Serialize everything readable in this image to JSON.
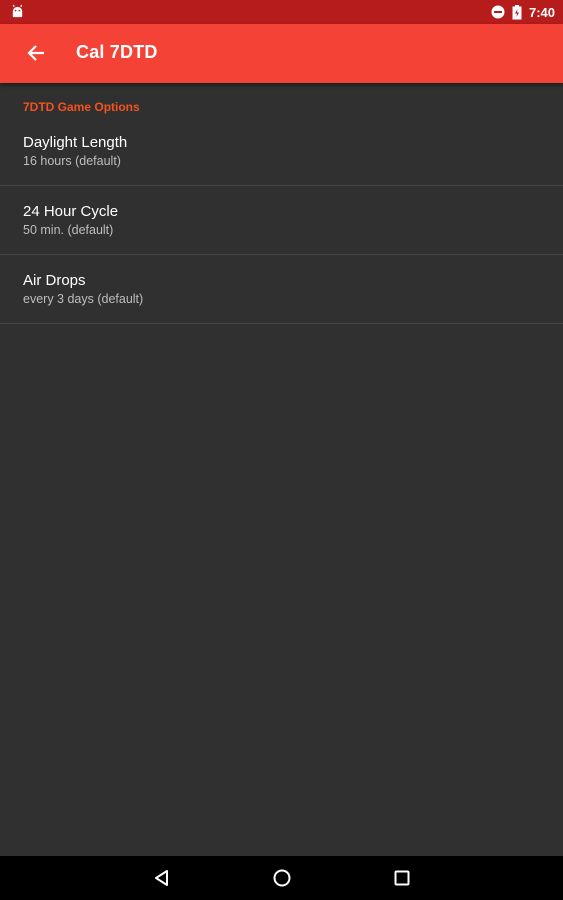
{
  "status_bar": {
    "time": "7:40",
    "icons": [
      "android-icon",
      "do-not-disturb-icon",
      "battery-icon"
    ]
  },
  "app_bar": {
    "title": "Cal 7DTD",
    "back_icon": "arrow-back-icon"
  },
  "preferences": {
    "section_title": "7DTD Game Options",
    "items": [
      {
        "title": "Daylight Length",
        "summary": "16 hours (default)"
      },
      {
        "title": "24 Hour Cycle",
        "summary": "50 min. (default)"
      },
      {
        "title": "Air Drops",
        "summary": "every 3 days (default)"
      }
    ]
  },
  "nav_bar": {
    "icons": [
      "back-triangle-icon",
      "home-circle-icon",
      "recents-square-icon"
    ]
  },
  "colors": {
    "status_bar": "#b71c1c",
    "app_bar": "#f44336",
    "section_header": "#f4511e",
    "background": "#303030"
  }
}
